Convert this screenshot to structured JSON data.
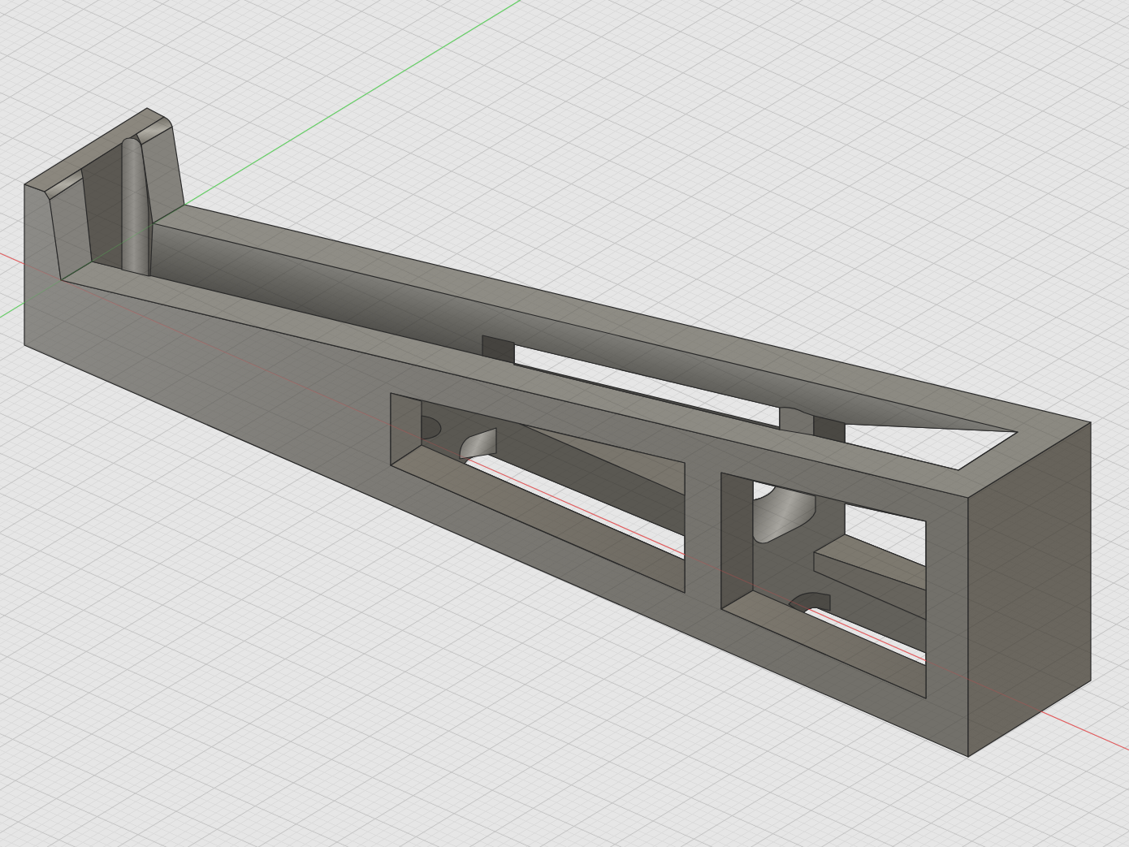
{
  "viewport": {
    "grid": true,
    "axes": [
      {
        "kind": "x",
        "color": "#e8595b"
      },
      {
        "kind": "y",
        "color": "#5fd35f"
      }
    ]
  }
}
